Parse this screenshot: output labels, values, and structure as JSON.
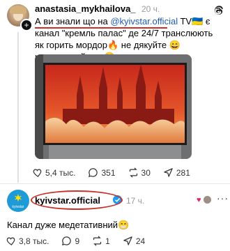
{
  "post1": {
    "username": "anastasia_mykhailova_",
    "time": "20 ч.",
    "text_before": "А ви знали що на ",
    "mention": "@kyivstar.official",
    "text_after": " TV🇺🇦 є канал \"кремль палас\" де 24/7 транслюють як горить мордор🔥 не дякуйте 😄 насолоджуйтесь😌",
    "likes": "5,4 тыс.",
    "comments": "351",
    "reposts": "30",
    "shares": "281"
  },
  "post2": {
    "username": "kyivstar.official",
    "time": "17 ч.",
    "avatar_label": "kyivstar",
    "text": "Канал дуже медетативний😁",
    "likes": "3,8 тыс.",
    "comments": "9",
    "reposts": "1",
    "shares": "24"
  },
  "colors": {
    "accent_red": "#c9322b",
    "mention_blue": "#1f5bb5",
    "verified_blue": "#1d9bf0",
    "kyivstar_blue": "#1e9bd7"
  },
  "icons": [
    "threads-logo-icon",
    "heart-icon",
    "comment-icon",
    "repost-icon",
    "share-icon",
    "verified-icon",
    "more-icon",
    "plus-icon"
  ]
}
